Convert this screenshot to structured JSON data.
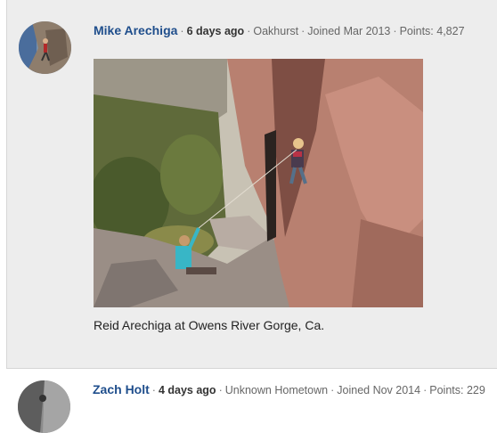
{
  "posts": [
    {
      "author": "Mike Arechiga",
      "time_ago": "6 days ago",
      "hometown": "Oakhurst",
      "joined": "Joined Mar 2013",
      "points": "Points: 4,827",
      "caption": "Reid Arechiga at Owens River Gorge, Ca."
    },
    {
      "author": "Zach Holt",
      "time_ago": "4 days ago",
      "hometown": "Unknown Hometown",
      "joined": "Joined Nov 2014",
      "points": "Points: 229"
    }
  ],
  "separator": "·",
  "icons": {
    "avatar_1": "climber-avatar",
    "avatar_2": "climber-avatar",
    "photo": "rock-climbing-photo"
  },
  "colors": {
    "author_link": "#1f4e8c",
    "post_background": "#ededed"
  }
}
